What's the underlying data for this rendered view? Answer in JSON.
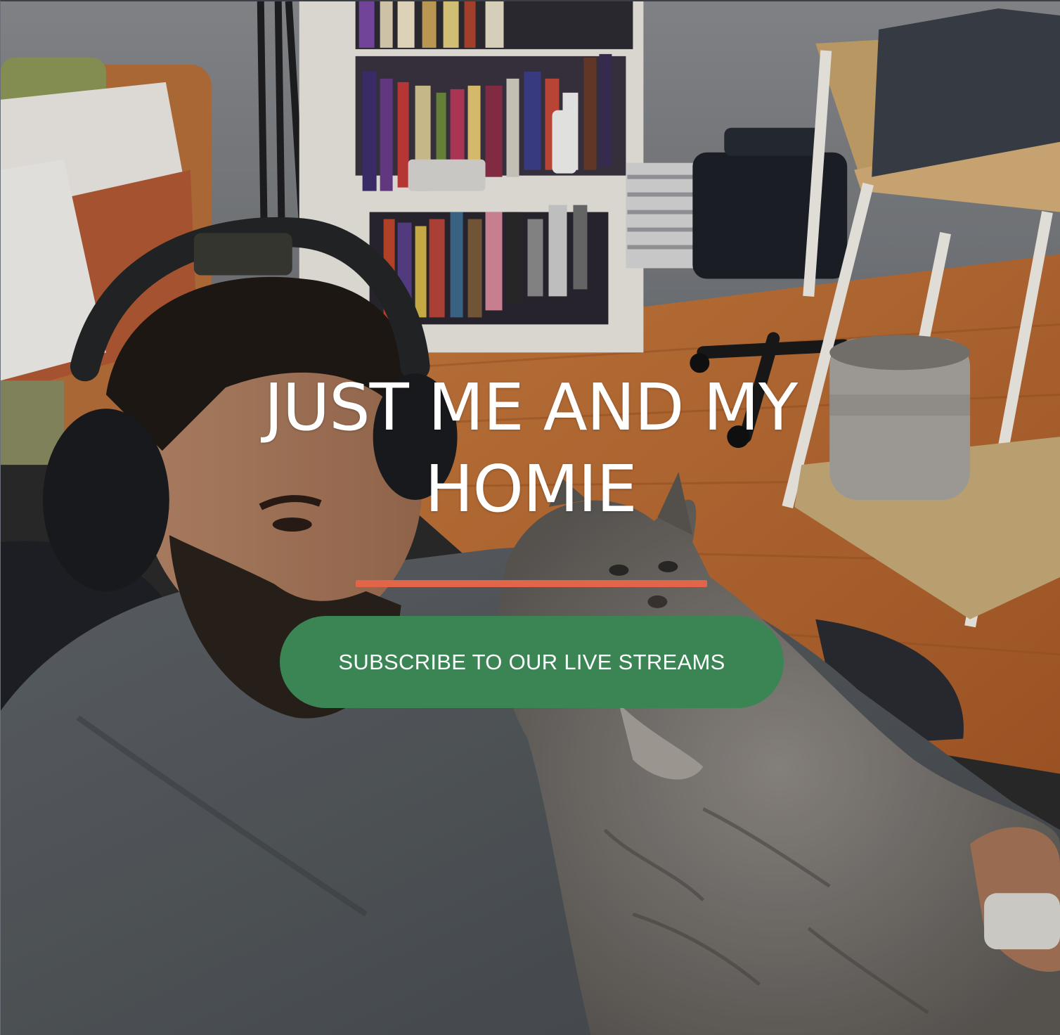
{
  "hero": {
    "title": "JUST ME AND MY HOMIE",
    "cta_label": "SUBSCRIBE TO OUR LIVE STREAMS",
    "accent_color": "#e2654a",
    "button_color": "#3a8553",
    "background_image": "photo-man-with-headphones-holding-gray-cat"
  }
}
